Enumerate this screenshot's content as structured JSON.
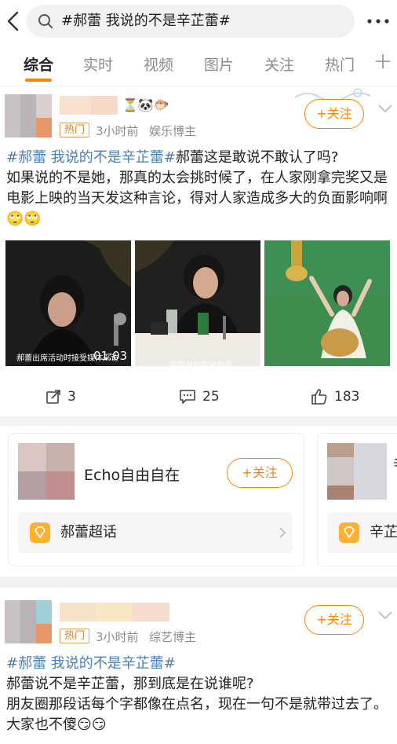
{
  "search": {
    "query": "#郝蕾 我说的不是辛芷蕾#"
  },
  "tabs": [
    {
      "label": "综合",
      "active": true
    },
    {
      "label": "实时"
    },
    {
      "label": "视频"
    },
    {
      "label": "图片"
    },
    {
      "label": "关注"
    },
    {
      "label": "热门"
    }
  ],
  "posts": [
    {
      "badge": "热门",
      "time": "3小时前",
      "category": "娱乐博主",
      "follow": "+关注",
      "topic": "#郝蕾 我说的不是辛芷蕾#",
      "text_first": "郝蕾这是敢说不敢认了吗?",
      "text_rest": "如果说的不是她，那真的太会挑时候了，在人家刚拿完奖又是电影上映的当天发这种言论，得对人家造成多大的负面影响啊🙄🙄",
      "images": [
        {
          "caption": "郝蕾出席活动时接受媒体采访",
          "duration": "01:03"
        },
        {
          "caption": "我我说的我说的是…"
        },
        {
          "caption": ""
        }
      ],
      "reposts": "3",
      "comments": "25",
      "likes": "183"
    },
    {
      "badge": "热门",
      "time": "3小时前",
      "category": "综艺博主",
      "follow": "+关注",
      "topic": "#郝蕾 我说的不是辛芷蕾#",
      "line1": "郝蕾说不是辛芷蕾，那到底是在说谁呢?",
      "line2": "朋友圈那段话每个字都像在点名，现在一句不是就带过去了。大家也不傻😏😏"
    }
  ],
  "recommend": [
    {
      "name": "Echo自由自在",
      "follow": "+关注",
      "supertopic": "郝蕾超话"
    },
    {
      "name": "辛",
      "follow": "",
      "supertopic": "辛芷"
    }
  ],
  "colors": {
    "accent": "#ff8200",
    "topic": "#4a7fb5"
  }
}
